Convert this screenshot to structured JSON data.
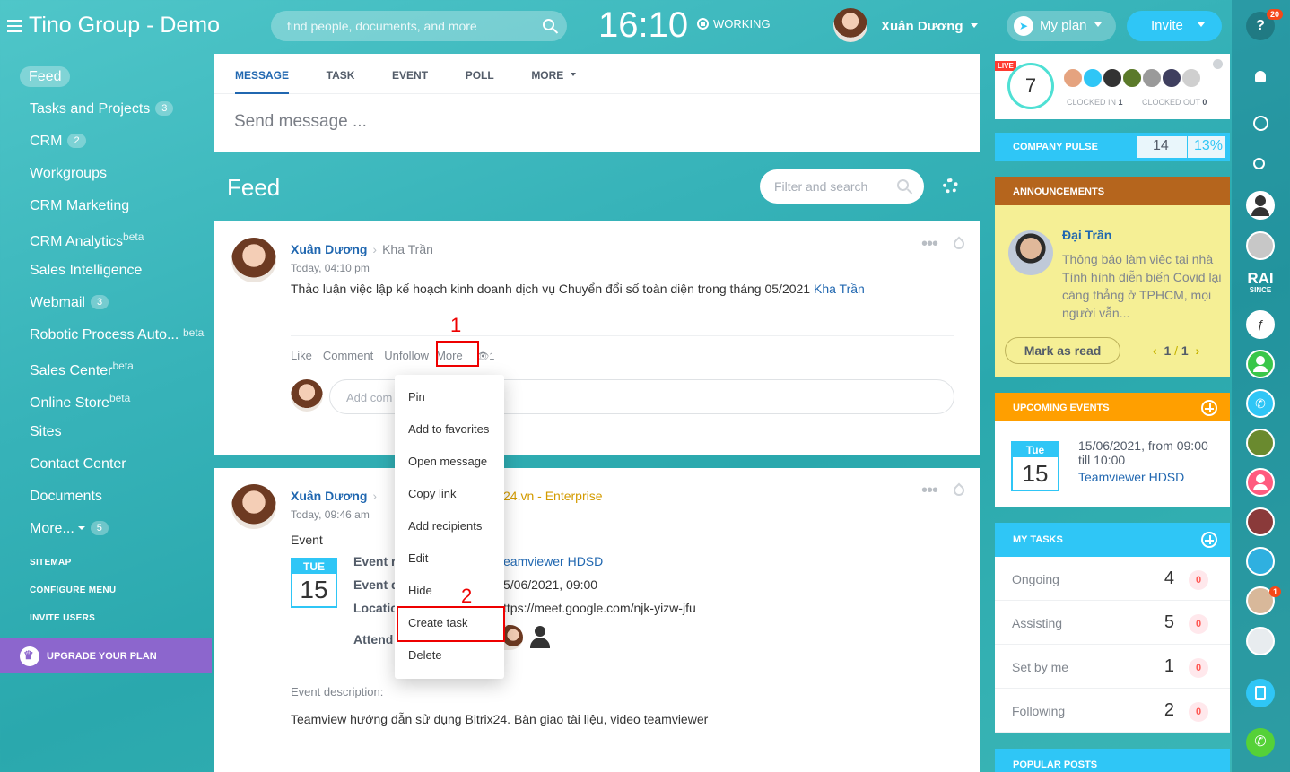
{
  "header": {
    "brand": "Tino Group - Demo",
    "search_placeholder": "find people, documents, and more",
    "time": "16:10",
    "status": "WORKING",
    "user": "Xuân Dương",
    "myplan": "My plan",
    "invite": "Invite",
    "help_badge": "20"
  },
  "sidebar": {
    "items": [
      {
        "label": "Feed"
      },
      {
        "label": "Tasks and Projects",
        "count": "3"
      },
      {
        "label": "CRM",
        "count": "2"
      },
      {
        "label": "Workgroups"
      },
      {
        "label": "CRM Marketing"
      },
      {
        "label": "CRM Analytics",
        "sup": "beta"
      },
      {
        "label": "Sales Intelligence"
      },
      {
        "label": "Webmail",
        "count": "3"
      },
      {
        "label": "Robotic Process Auto...",
        "sup": "beta"
      },
      {
        "label": "Sales Center",
        "sup": "beta"
      },
      {
        "label": "Online Store",
        "sup": "beta"
      },
      {
        "label": "Sites"
      },
      {
        "label": "Contact Center"
      },
      {
        "label": "Documents"
      },
      {
        "label": "More...",
        "count": "5"
      }
    ],
    "sitemap": "SITEMAP",
    "configure": "CONFIGURE MENU",
    "invite_users": "INVITE USERS",
    "upgrade": "UPGRADE YOUR PLAN"
  },
  "composer": {
    "tabs": [
      "MESSAGE",
      "TASK",
      "EVENT",
      "POLL",
      "MORE"
    ],
    "placeholder": "Send message ..."
  },
  "feed": {
    "title": "Feed",
    "filter_placeholder": "Filter and search"
  },
  "post1": {
    "author": "Xuân Dương",
    "recipient": "Kha Trần",
    "time": "Today, 04:10 pm",
    "text": "Thảo luận việc lập kế hoạch kinh doanh dịch vụ Chuyển đổi số toàn diện trong tháng 05/2021",
    "mention": "Kha Trần",
    "actions": {
      "like": "Like",
      "comment": "Comment",
      "unfollow": "Unfollow",
      "more": "More",
      "views": "1"
    },
    "comment_placeholder": "Add com"
  },
  "post2": {
    "author": "Xuân Dương",
    "recipient_tail": "24.vn - Enterprise",
    "time": "Today, 09:46 am",
    "type": "Event",
    "cal_month": "TUE",
    "cal_day": "15",
    "label_name": "Event r",
    "value_name": "eamviewer HDSD",
    "label_date": "Event d",
    "value_date": "5/06/2021, 09:00",
    "label_loc": "Locatic",
    "value_loc": "ttps://meet.google.com/njk-yizw-jfu",
    "label_att": "Attend",
    "desc_label": "Event description:",
    "desc": "Teamview hướng dẫn sử dụng Bitrix24. Bàn giao tài liệu, video teamviewer"
  },
  "menu": {
    "items": [
      "Pin",
      "Add to favorites",
      "Open message",
      "Copy link",
      "Add recipients",
      "Edit",
      "Hide",
      "Create task",
      "Delete"
    ]
  },
  "annotations": {
    "step1": "1",
    "step2": "2"
  },
  "timeman": {
    "live": "LIVE",
    "count": "7",
    "clocked_in_label": "CLOCKED IN",
    "clocked_in": "1",
    "clocked_out_label": "CLOCKED OUT",
    "clocked_out": "0"
  },
  "pulse": {
    "label": "COMPANY PULSE",
    "value": "14",
    "percent": "13%"
  },
  "announcements": {
    "title": "ANNOUNCEMENTS",
    "author": "Đại Trần",
    "text": "Thông báo làm việc tại nhà Tình hình diễn biến Covid lại căng thẳng ở TPHCM, mọi người vẫn...",
    "button": "Mark as read",
    "page": "1",
    "sep": "/",
    "total": "1"
  },
  "events": {
    "title": "UPCOMING EVENTS",
    "cal_month": "Tue",
    "cal_day": "15",
    "when": "15/06/2021, from 09:00",
    "till": "till 10:00",
    "name": "Teamviewer HDSD"
  },
  "tasks": {
    "title": "MY TASKS",
    "rows": [
      {
        "label": "Ongoing",
        "count": "4",
        "badge": "0"
      },
      {
        "label": "Assisting",
        "count": "5",
        "badge": "0"
      },
      {
        "label": "Set by me",
        "count": "1",
        "badge": "0"
      },
      {
        "label": "Following",
        "count": "2",
        "badge": "0"
      }
    ]
  },
  "popular": {
    "title": "POPULAR POSTS"
  },
  "strip": {
    "badge": "1",
    "rai": "RAI",
    "since": "SINCE"
  },
  "colors": {
    "accent": "#2067b0",
    "cyan": "#2fc6f6",
    "orange": "#ff9f00",
    "brown": "#b5651d",
    "yellow": "#f5ef95",
    "red": "#e00000"
  }
}
